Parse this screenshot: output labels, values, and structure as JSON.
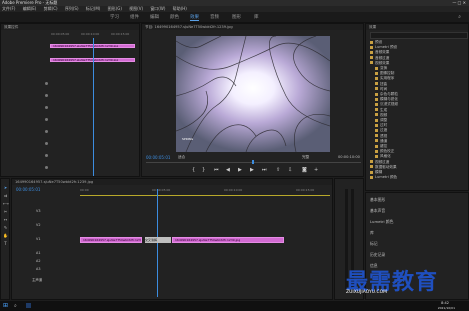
{
  "app": {
    "title": "Adobe Premiere Pro - 无标题"
  },
  "menu": [
    "文件(F)",
    "编辑(E)",
    "剪辑(C)",
    "序列(S)",
    "标记(M)",
    "图形(G)",
    "视图(V)",
    "窗口(W)",
    "帮助(H)"
  ],
  "workspaces": {
    "tabs": [
      "学习",
      "组件",
      "编辑",
      "颜色",
      "效果",
      "音频",
      "图形",
      "库"
    ],
    "active_index": 4
  },
  "effect_controls": {
    "title": "效果控件",
    "clip_name": "164990164957.sJuNe7T50wbkt2fr.1239.jpg",
    "clip_name_2": "164990164957.sJuNe7T50wbkt2fr.1239.jpg",
    "timecodes": [
      "00:00:05:00",
      "00:00:10:00",
      "00:00:15:00"
    ]
  },
  "program_monitor": {
    "title": "节目: 164990164957.sJuNe7T50wbkt2fr.1239.jpg",
    "timecode": "00:00:05:01",
    "fit_label": "适合",
    "quality_label": "完整",
    "duration": "00:00:10:00",
    "photo_tag": "SPRING"
  },
  "effects_panel": {
    "title": "效果",
    "items": [
      "预设",
      "Lumetri 预设",
      "音频效果",
      "音频过渡",
      "视频效果",
      "变换",
      "图像控制",
      "实用程序",
      "扭曲",
      "时间",
      "杂色与颗粒",
      "模糊与锐化",
      "沉浸式视频",
      "生成",
      "视频",
      "调整",
      "过时",
      "过渡",
      "透视",
      "通道",
      "键控",
      "颜色校正",
      "风格化",
      "视频过渡",
      "数据驱动效果",
      "模糊",
      "Lumetri 颜色"
    ],
    "lower_panels": [
      "基本图形",
      "基本声音",
      "Lumetri 颜色",
      "库",
      "标记",
      "历史记录",
      "信息"
    ]
  },
  "timeline": {
    "title": "164990164957.sJuNe7T50wbkt2fr.1239.jpg",
    "timecode": "00:00:05:01",
    "ruler": [
      "00:00",
      "00:00:05:00",
      "00:00:10:00",
      "00:00:15:00"
    ],
    "tracks": [
      "V3",
      "V2",
      "V1",
      "A1",
      "A2",
      "A3"
    ],
    "master_label": "主声道",
    "clip_a": "164990164957.sJuNe7T50wbkt2fr.1239.jpg",
    "clip_b": "164990164957.sJuNe7T50wbkt2fr.1239.jpg",
    "transition_label": "交叉溶解"
  },
  "watermark": {
    "text": "最需教育",
    "sub": "ZUIXUJIAOYU.COM"
  },
  "taskbar": {
    "time": "8:42",
    "date": "2021/10/01"
  }
}
